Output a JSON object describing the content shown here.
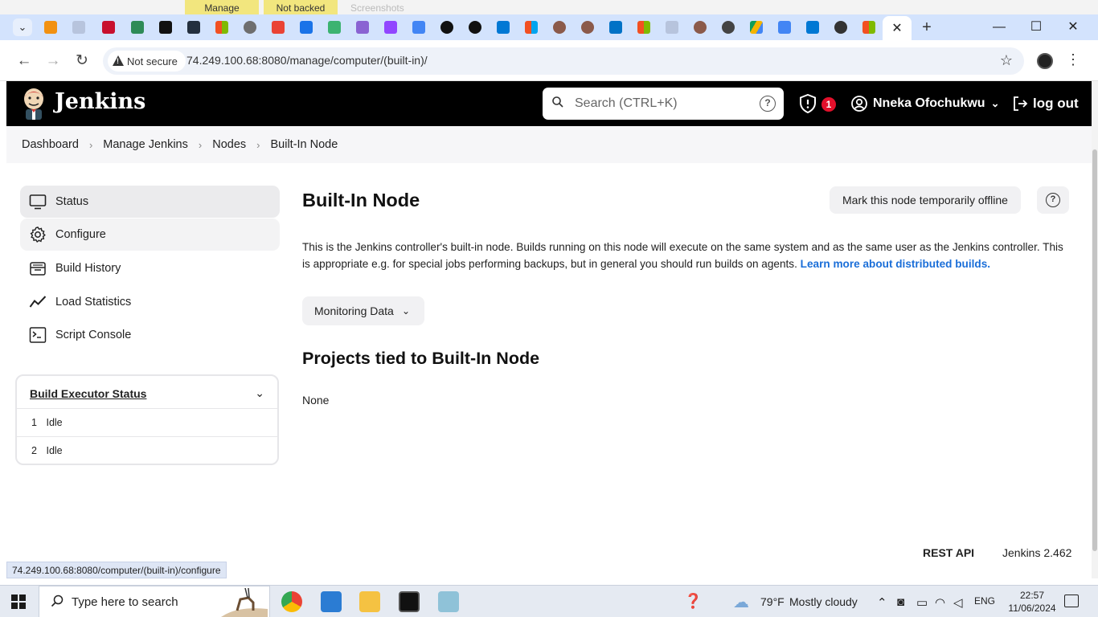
{
  "background_window": {
    "tabs": [
      "Manage",
      "Not backed up",
      "Screenshots"
    ]
  },
  "browser": {
    "active_tab_close": "✕",
    "new_tab": "+",
    "window_controls": {
      "minimize": "—",
      "maximize": "☐",
      "close": "✕"
    },
    "nav": {
      "back": "←",
      "forward": "→",
      "reload": "↻"
    },
    "security_chip": "Not secure",
    "url": "74.249.100.68:8080/manage/computer/(built-in)/",
    "status_url": "74.249.100.68:8080/computer/(built-in)/configure"
  },
  "jenkins": {
    "brand": "Jenkins",
    "search": {
      "placeholder": "Search (CTRL+K)",
      "help": "?"
    },
    "alert_count": "1",
    "user_name": "Nneka Ofochukwu",
    "logout": "log out",
    "breadcrumb": [
      "Dashboard",
      "Manage Jenkins",
      "Nodes",
      "Built-In Node"
    ],
    "sidebar": {
      "items": [
        {
          "label": "Status",
          "icon": "monitor-icon",
          "state": "selected"
        },
        {
          "label": "Configure",
          "icon": "gear-icon",
          "state": "hover"
        },
        {
          "label": "Build History",
          "icon": "history-icon",
          "state": ""
        },
        {
          "label": "Load Statistics",
          "icon": "trend-icon",
          "state": ""
        },
        {
          "label": "Script Console",
          "icon": "terminal-icon",
          "state": ""
        }
      ]
    },
    "executor": {
      "title": "Build Executor Status",
      "rows": [
        {
          "num": "1",
          "status": "Idle"
        },
        {
          "num": "2",
          "status": "Idle"
        }
      ]
    },
    "main": {
      "title": "Built-In Node",
      "offline_button": "Mark this node temporarily offline",
      "help": "?",
      "description": "This is the Jenkins controller's built-in node. Builds running on this node will execute on the same system and as the same user as the Jenkins controller. This is appropriate e.g. for special jobs performing backups, but in general you should run builds on agents.",
      "learn_more": "Learn more about distributed builds.",
      "monitoring_button": "Monitoring Data",
      "projects_title": "Projects tied to Built-In Node",
      "projects_value": "None"
    },
    "footer": {
      "rest_api": "REST API",
      "version": "Jenkins 2.462"
    }
  },
  "taskbar": {
    "search_text": "Type here to search",
    "weather": {
      "temp": "79°F",
      "condition": "Mostly cloudy"
    },
    "language": "ENG",
    "time": "22:57",
    "date": "11/06/2024"
  },
  "colors": {
    "tab_strip": "#d3e3fd",
    "jenkins_header": "#000000",
    "link_blue": "#1a6ed8",
    "alert_red": "#e3102b"
  }
}
